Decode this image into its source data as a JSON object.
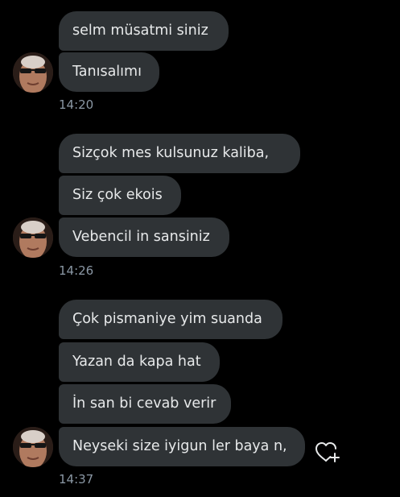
{
  "conversation": {
    "groups": [
      {
        "messages": [
          "selm müsatmi  siniz",
          "Tanısalımı"
        ],
        "time": "14:20"
      },
      {
        "messages": [
          "Sizçok  mes  kulsunuz kaliba,",
          "Siz çok ekois",
          "Vebencil in sansiniz"
        ],
        "time": "14:26"
      },
      {
        "messages": [
          "Çok pismaniye yim suanda",
          "Yazan da kapa hat",
          "İn san bi cevab verir",
          "Neyseki size iyigun ler baya n,"
        ],
        "time": "14:37"
      }
    ]
  },
  "icons": {
    "reaction": "heart-plus-icon",
    "avatar": "user-avatar"
  },
  "colors": {
    "background": "#000000",
    "bubble": "#2f3336",
    "text": "#e7e9ea",
    "timestamp": "#8b98a5"
  }
}
